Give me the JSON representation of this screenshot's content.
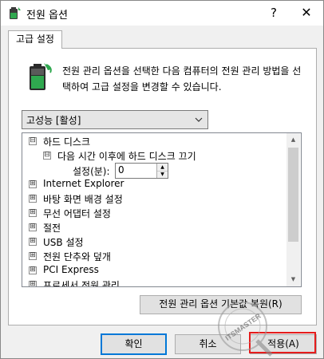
{
  "window": {
    "title": "전원 옵션",
    "help_glyph": "?",
    "close_glyph": "✕",
    "title_icon": "power-options-icon"
  },
  "tab": {
    "label": "고급 설정"
  },
  "description": "전원 관리 옵션을 선택한 다음 컴퓨터의 전원 관리 방법을 선택하여 고급 설정을 변경할 수 있습니다.",
  "plan_select": {
    "value": "고성능 [활성]"
  },
  "tree": {
    "items": [
      {
        "label": "하드 디스크",
        "expander": "⊟"
      },
      {
        "label": "다음 시간 이후에 하드 디스크 끄기",
        "expander": "⊟"
      },
      {
        "label": "Internet Explorer",
        "expander": "⊞"
      },
      {
        "label": "바탕 화면 배경 설정",
        "expander": "⊞"
      },
      {
        "label": "무선 어댑터 설정",
        "expander": "⊞"
      },
      {
        "label": "절전",
        "expander": "⊞"
      },
      {
        "label": "USB 설정",
        "expander": "⊞"
      },
      {
        "label": "전원 단추와 덮개",
        "expander": "⊞"
      },
      {
        "label": "PCI Express",
        "expander": "⊞"
      },
      {
        "label": "프로세서 전원 관리",
        "expander": "⊞"
      }
    ],
    "setting_label": "설정(분):",
    "setting_value": "0"
  },
  "buttons": {
    "restore": "전원 관리 옵션 기본값 복원(R)",
    "ok": "확인",
    "cancel": "취소",
    "apply": "적용(A)"
  },
  "watermark": {
    "text": "ITSMASTER"
  },
  "colors": {
    "accent": "#0078d7",
    "highlight": "#e51c1c",
    "battery_green": "#2fa84f"
  }
}
